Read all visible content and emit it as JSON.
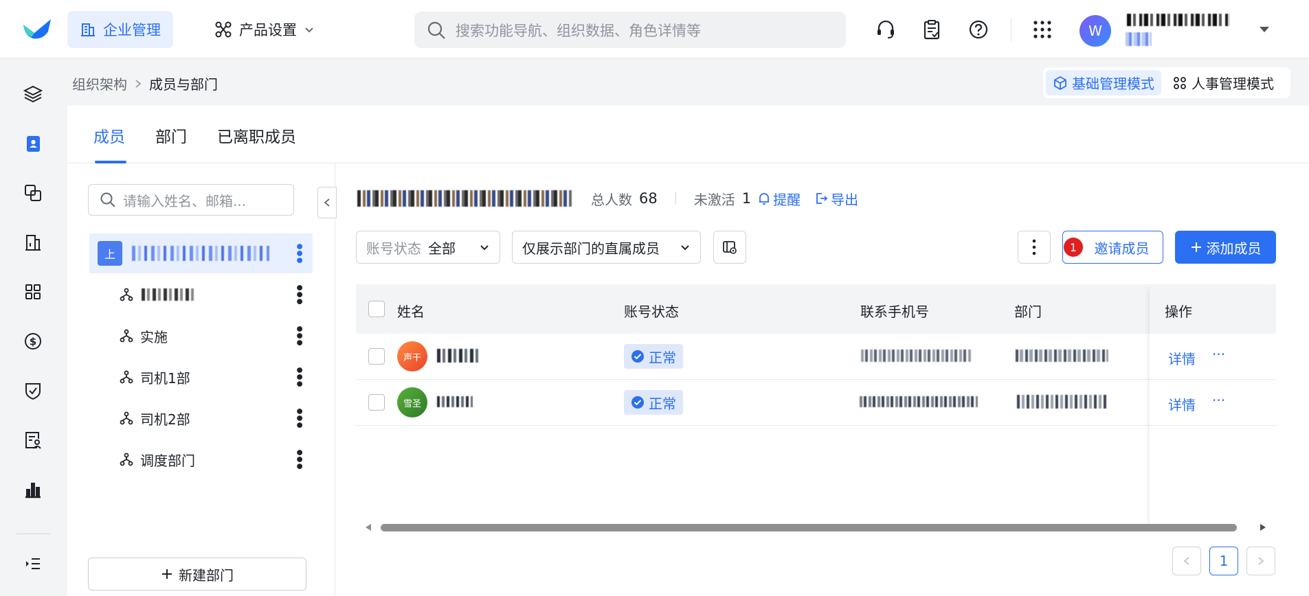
{
  "header": {
    "nav_enterprise": "企业管理",
    "nav_product": "产品设置",
    "search_placeholder": "搜索功能导航、组织数据、角色详情等",
    "avatar_letter": "W"
  },
  "breadcrumb": {
    "parent": "组织架构",
    "current": "成员与部门"
  },
  "modes": {
    "basic": "基础管理模式",
    "hr": "人事管理模式"
  },
  "tabs": [
    "成员",
    "部门",
    "已离职成员"
  ],
  "tree": {
    "search_placeholder": "请输入姓名、邮箱...",
    "root_badge": "上",
    "items": [
      "实施",
      "司机1部",
      "司机2部",
      "调度部门"
    ],
    "new_dept": "新建部门"
  },
  "summary": {
    "total_label": "总人数",
    "total": "68",
    "inactive_label": "未激活",
    "inactive": "1",
    "remind": "提醒",
    "export": "导出"
  },
  "filters": {
    "account_status_key": "账号状态",
    "account_status_value": "全部",
    "direct_members": "仅展示部门的直属成员"
  },
  "actions": {
    "invite": "邀请成员",
    "invite_badge": "1",
    "add": "添加成员"
  },
  "table": {
    "columns": [
      "姓名",
      "账号状态",
      "联系手机号",
      "部门",
      "操作"
    ],
    "rows": [
      {
        "avatar": "声干",
        "avatar_color": "#f26a36",
        "status": "正常",
        "detail": "详情",
        "more": "···"
      },
      {
        "avatar": "雪圣",
        "avatar_color": "#3f9a2e",
        "status": "正常",
        "detail": "详情",
        "more": "···"
      }
    ]
  },
  "pagination": {
    "current": "1"
  },
  "colors": {
    "accent": "#2b6ff2",
    "danger": "#e02020"
  }
}
